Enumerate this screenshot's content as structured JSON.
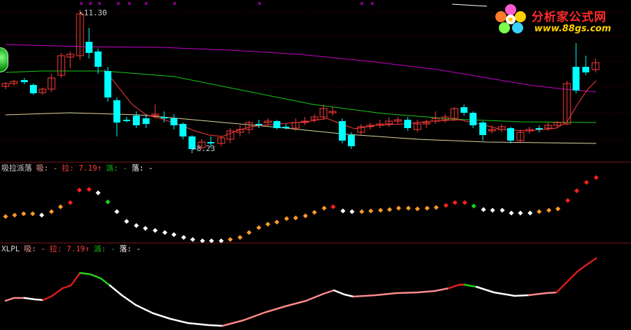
{
  "panels": {
    "main": {
      "high_label": "11.30",
      "low_label": "8.23",
      "markers": [
        "×",
        "×",
        "×",
        "×",
        "×",
        "×",
        "×",
        "×",
        "×",
        "×"
      ]
    },
    "indicator1": {
      "name": "吸拉派落",
      "xi": "吸: -",
      "la": "拉: 7.19↑",
      "pai": "派: -",
      "luo": "落: -"
    },
    "indicator2": {
      "name": "XLPL",
      "xi": "吸: -",
      "la": "拉: 7.19↑",
      "pai": "派: -",
      "luo": "落: -"
    }
  },
  "watermark": {
    "title": "分析家公式网",
    "url": "www.88gs.com"
  },
  "colors": {
    "up": "#ff3b3b",
    "down": "#00ffff",
    "ma_short": "#ff3b3b",
    "ma_mid": "#19c819",
    "ma_long": "#c800c8",
    "ma_slow": "#d8d8a0",
    "dot_orange": "#ff9a2a",
    "dot_white": "#ffffff",
    "dot_red": "#ff2020",
    "dot_green": "#19d219",
    "line_pink": "#ff8a8a",
    "line_red": "#dd1a1a",
    "line_white": "#ffffff",
    "line_green": "#19d219",
    "separator": "#7a1a1a"
  }
}
